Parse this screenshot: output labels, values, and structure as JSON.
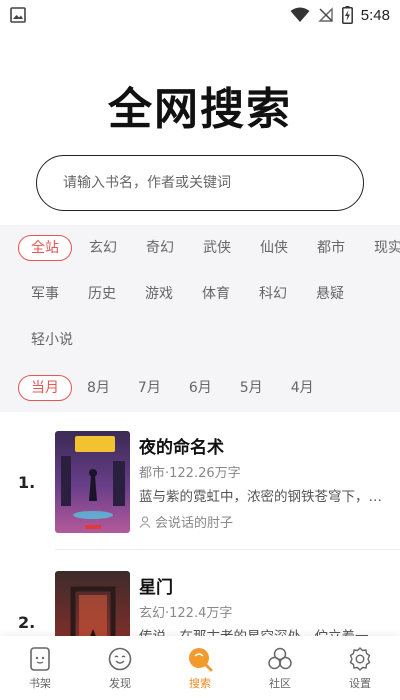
{
  "status_bar": {
    "time": "5:48"
  },
  "header": {
    "title": "全网搜索"
  },
  "search": {
    "placeholder": "请输入书名，作者或关键词"
  },
  "filters": {
    "categories_row1": [
      "全站",
      "玄幻",
      "奇幻",
      "武侠",
      "仙侠",
      "都市",
      "现实"
    ],
    "categories_row2": [
      "军事",
      "历史",
      "游戏",
      "体育",
      "科幻",
      "悬疑"
    ],
    "categories_row3": [
      "轻小说"
    ],
    "selected_category": "全站",
    "months": [
      "当月",
      "8月",
      "7月",
      "6月",
      "5月",
      "4月"
    ],
    "selected_month": "当月"
  },
  "books": [
    {
      "rank": "1.",
      "title": "夜的命名术",
      "meta": "都市·122.26万字",
      "desc": "蓝与紫的霓虹中，浓密的钢铁苍穹下，数据洪流的前端，是科技革命之后的世界。",
      "author": "会说话的肘子"
    },
    {
      "rank": "2.",
      "title": "星门",
      "meta": "玄幻·122.4万字",
      "desc": "传说，在那古老的星空深处，伫立着一道血与火侵染的红色之门……"
    }
  ],
  "bottom_nav": {
    "items": [
      {
        "label": "书架",
        "icon": "bookshelf-icon"
      },
      {
        "label": "发现",
        "icon": "discover-icon"
      },
      {
        "label": "搜索",
        "icon": "search-icon"
      },
      {
        "label": "社区",
        "icon": "community-icon"
      },
      {
        "label": "设置",
        "icon": "settings-icon"
      }
    ],
    "active": "搜索"
  },
  "colors": {
    "accent_red": "#e85555",
    "accent_orange": "#f08a24",
    "filter_bg": "#f5f5f7"
  }
}
